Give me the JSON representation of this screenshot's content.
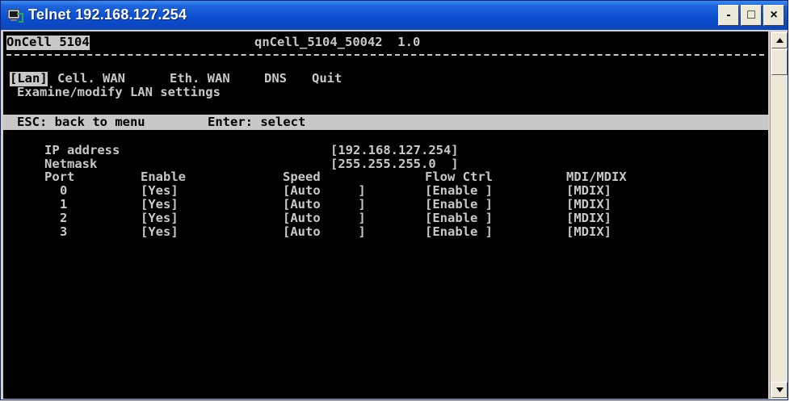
{
  "window": {
    "title": "Telnet 192.168.127.254",
    "buttons": {
      "minimize": "-",
      "maximize": "□",
      "close": "×"
    }
  },
  "terminal": {
    "header": {
      "device": "OnCell 5104",
      "model_line": "qnCell_5104_50042  1.0"
    },
    "menu": {
      "items": [
        {
          "label": "[Lan]",
          "selected": true
        },
        {
          "label": "Cell. WAN",
          "selected": false
        },
        {
          "label": "Eth. WAN",
          "selected": false
        },
        {
          "label": "DNS",
          "selected": false
        },
        {
          "label": "Quit",
          "selected": false
        }
      ],
      "description": "Examine/modify LAN settings"
    },
    "statusbar": {
      "esc_hint": "ESC: back to menu",
      "enter_hint": "Enter: select"
    },
    "settings": {
      "ip_label": "IP address",
      "ip_value": "[192.168.127.254]",
      "netmask_label": "Netmask",
      "netmask_value": "[255.255.255.0  ]"
    },
    "ports_table": {
      "columns": [
        "Port",
        "Enable",
        "Speed",
        "Flow Ctrl",
        "MDI/MDIX"
      ],
      "rows": [
        {
          "port": "0",
          "enable": "[Yes]",
          "speed": "[Auto     ]",
          "flow": "[Enable ]",
          "mdi": "[MDIX]"
        },
        {
          "port": "1",
          "enable": "[Yes]",
          "speed": "[Auto     ]",
          "flow": "[Enable ]",
          "mdi": "[MDIX]"
        },
        {
          "port": "2",
          "enable": "[Yes]",
          "speed": "[Auto     ]",
          "flow": "[Enable ]",
          "mdi": "[MDIX]"
        },
        {
          "port": "3",
          "enable": "[Yes]",
          "speed": "[Auto     ]",
          "flow": "[Enable ]",
          "mdi": "[MDIX]"
        }
      ]
    }
  },
  "colors": {
    "titlebar": "#0a4ed0",
    "terminal_bg": "#000000",
    "terminal_fg": "#c8c8c8"
  }
}
